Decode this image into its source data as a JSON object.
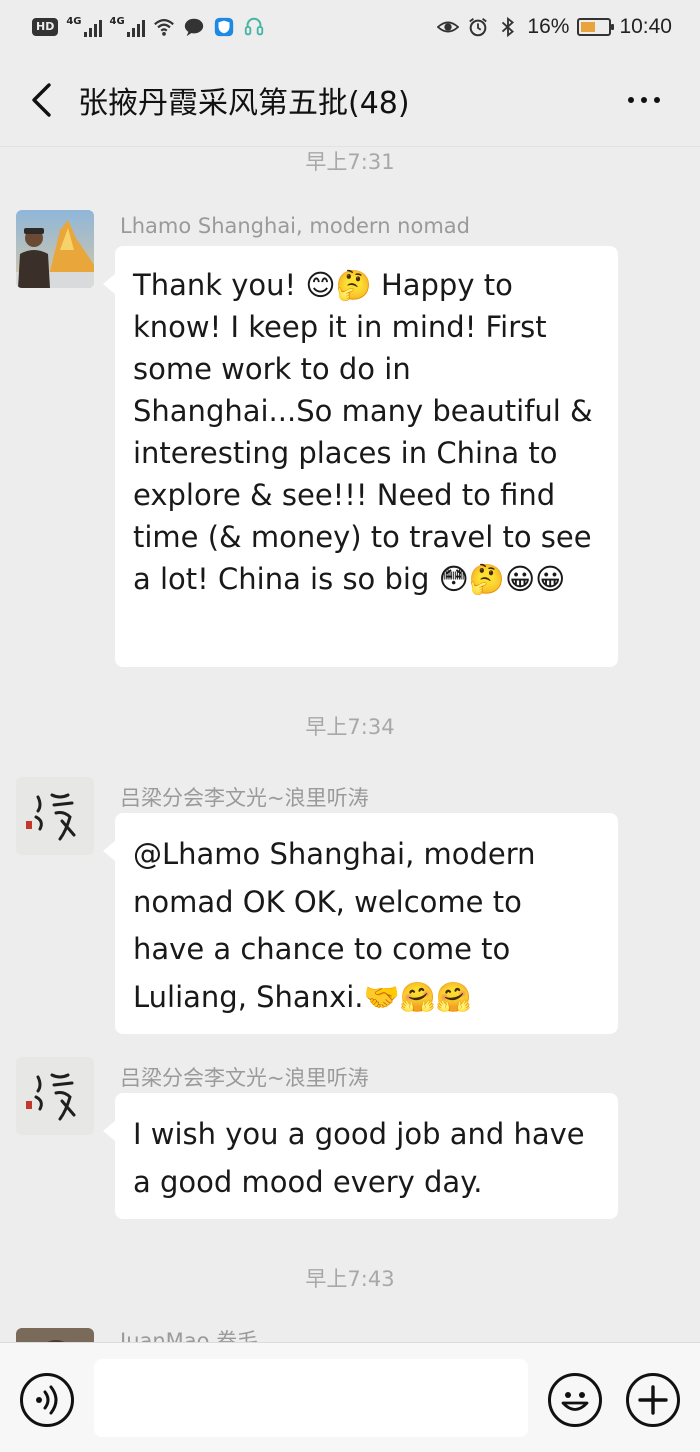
{
  "status_bar": {
    "hd": "HD",
    "net1": "4G",
    "net2": "4G",
    "battery_pct": "16%",
    "time": "10:40",
    "icons": [
      "wifi-icon",
      "chat-bubble-icon",
      "shield-icon",
      "headset-icon",
      "eye-icon",
      "alarm-icon",
      "bluetooth-icon",
      "battery-icon"
    ]
  },
  "header": {
    "title": "张掖丹霞采风第五批(48)",
    "back_icon": "chevron-left-icon",
    "more_icon": "more-dots-icon"
  },
  "timestamps": [
    "早上7:31",
    "早上7:34",
    "早上7:43"
  ],
  "messages": [
    {
      "sender": "Lhamo Shanghai, modern nomad",
      "text": "Thank you! 😊🤔 Happy to know! I keep it in mind! First some work to do in Shanghai...So many beautiful & interesting places in China to explore & see!!! Need to find time (& money) to travel to see a lot! China is so big 😳🤔😀😀"
    },
    {
      "sender": "吕梁分会李文光~浪里听涛",
      "text": "@Lhamo Shanghai, modern nomad OK OK, welcome to have a chance to come to Luliang, Shanxi.🤝🤗🤗"
    },
    {
      "sender": "吕梁分会李文光~浪里听涛",
      "text": "I wish you a good job and have a good mood every day."
    },
    {
      "sender": "JuanMao 卷毛",
      "text": ""
    }
  ],
  "input_bar": {
    "value": "",
    "placeholder": "",
    "voice_icon": "voice-icon",
    "emoji_icon": "emoji-icon",
    "plus_icon": "plus-icon"
  },
  "colors": {
    "background": "#ededed",
    "bubble": "#ffffff",
    "timestamp": "#a8a8a8",
    "sender": "#9a9a9a"
  }
}
